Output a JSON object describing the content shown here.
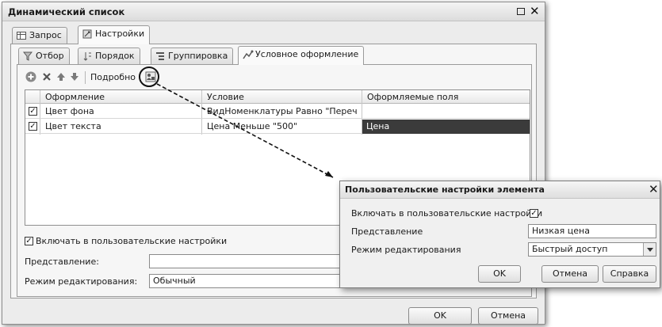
{
  "window": {
    "title": "Динамический список"
  },
  "tabs_top": [
    {
      "label": "Запрос",
      "icon": "table-icon"
    },
    {
      "label": "Настройки",
      "icon": "settings-icon"
    }
  ],
  "tabs_inner": [
    {
      "label": "Отбор",
      "icon": "filter-icon"
    },
    {
      "label": "Порядок",
      "icon": "sort-icon"
    },
    {
      "label": "Группировка",
      "icon": "group-icon"
    },
    {
      "label": "Условное оформление",
      "icon": "conditional-format-icon"
    }
  ],
  "toolbar": {
    "details_label": "Подробно"
  },
  "grid": {
    "columns": [
      "Оформление",
      "Условие",
      "Оформляемые поля"
    ],
    "rows": [
      {
        "checked": true,
        "appearance": "Цвет фона",
        "condition": "ВидНоменклатуры Равно \"Перечисл...",
        "fields": ""
      },
      {
        "checked": true,
        "appearance": "Цвет текста",
        "condition": "Цена Меньше \"500\"",
        "fields": "Цена"
      }
    ]
  },
  "form": {
    "include_label": "Включать в пользовательские настройки",
    "include_checked": true,
    "presentation_label": "Представление:",
    "presentation_value": "",
    "edit_mode_label": "Режим редактирования:",
    "edit_mode_value": "Обычный"
  },
  "buttons": {
    "ok": "OK",
    "cancel": "Отмена"
  },
  "popup": {
    "title": "Пользовательские настройки элемента",
    "include_label": "Включать в пользовательские настройки",
    "include_checked": true,
    "presentation_label": "Представление",
    "presentation_value": "Низкая цена",
    "edit_mode_label": "Режим редактирования",
    "edit_mode_value": "Быстрый доступ",
    "ok": "OK",
    "cancel": "Отмена",
    "help": "Справка"
  },
  "colors": {
    "selection": "#3b3b3b",
    "window_bg": "#ececec",
    "callout": "#111111"
  }
}
